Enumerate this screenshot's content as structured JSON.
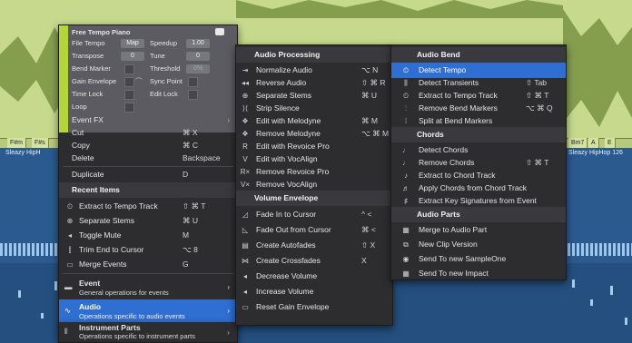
{
  "colors": {
    "audio_track": "#c6d98c",
    "blue_track": "#2a5a8e",
    "menu_bg": "#2d2d30",
    "highlight": "#2f6fd1",
    "tempo_accent": "#b6d43c"
  },
  "background": {
    "chords": [
      "F#m",
      "F#s",
      "Bm7",
      "A",
      "E"
    ],
    "clip_left": "Sleazy HipH",
    "clip_right": "Sleazy HipHop 126"
  },
  "tempo_panel": {
    "title": "Free Tempo Piano",
    "file_tempo_label": "File Tempo",
    "file_tempo_value": "Map",
    "speedup_label": "Speedup",
    "speedup_value": "1.00",
    "transpose_label": "Transpose",
    "transpose_value": "0",
    "tune_label": "Tune",
    "tune_value": "0",
    "bend_marker_label": "Bend Marker",
    "threshold_label": "Threshold",
    "threshold_value": "0%",
    "gain_envelope_label": "Gain Envelope",
    "sync_point_label": "Sync Point",
    "time_lock_label": "Time Lock",
    "edit_lock_label": "Edit Lock",
    "loop_label": "Loop"
  },
  "left_menu": {
    "items": [
      {
        "label": "Event FX",
        "shortcut": "",
        "icon": "",
        "arrow": true
      },
      {
        "label": "Cut",
        "shortcut": "⌘ X",
        "icon": ""
      },
      {
        "label": "Copy",
        "shortcut": "⌘ C",
        "icon": ""
      },
      {
        "label": "Delete",
        "shortcut": "Backspace",
        "icon": ""
      },
      {
        "label": "Duplicate",
        "shortcut": "D",
        "icon": ""
      }
    ],
    "recent_header": "Recent Items",
    "recent": [
      {
        "label": "Extract to Tempo Track",
        "shortcut": "⇧ ⌘ T",
        "icon": "tempo-icon"
      },
      {
        "label": "Separate Stems",
        "shortcut": "⌘ U",
        "icon": "stems-icon"
      },
      {
        "label": "Toggle Mute",
        "shortcut": "M",
        "icon": "mute-icon"
      },
      {
        "label": "Trim End to Cursor",
        "shortcut": "⌥ 8",
        "icon": "trim-icon"
      },
      {
        "label": "Merge Events",
        "shortcut": "G",
        "icon": "merge-icon"
      }
    ],
    "groups": [
      {
        "title": "Event",
        "subtitle": "General operations for events",
        "icon": "event-icon"
      },
      {
        "title": "Audio",
        "subtitle": "Operations specific to audio events",
        "icon": "audio-icon"
      },
      {
        "title": "Instrument Parts",
        "subtitle": "Operations specific to instrument parts",
        "icon": "instrument-icon"
      }
    ]
  },
  "mid_menu": {
    "processing_header": "Audio Processing",
    "processing": [
      {
        "label": "Normalize Audio",
        "shortcut": "⌥ N",
        "icon": "normalize-icon"
      },
      {
        "label": "Reverse Audio",
        "shortcut": "⇧ ⌘ R",
        "icon": "reverse-icon"
      },
      {
        "label": "Separate Stems",
        "shortcut": "⌘ U",
        "icon": "stems-icon"
      },
      {
        "label": "Strip Silence",
        "shortcut": "",
        "icon": "strip-icon"
      },
      {
        "label": "Edit with Melodyne",
        "shortcut": "⌘ M",
        "icon": "melodyne-icon"
      },
      {
        "label": "Remove Melodyne",
        "shortcut": "⌥ ⌘ M",
        "icon": "melodyne-remove-icon"
      },
      {
        "label": "Edit with Revoice Pro",
        "shortcut": "",
        "icon": "revoice-icon"
      },
      {
        "label": "Edit with VocAlign",
        "shortcut": "",
        "icon": "vocalign-icon"
      },
      {
        "label": "Remove Revoice Pro",
        "shortcut": "",
        "icon": "revoice-remove-icon"
      },
      {
        "label": "Remove VocAlign",
        "shortcut": "",
        "icon": "vocalign-remove-icon"
      }
    ],
    "envelope_header": "Volume Envelope",
    "envelope": [
      {
        "label": "Fade In to Cursor",
        "shortcut": "^ <",
        "icon": "fade-in-icon"
      },
      {
        "label": "Fade Out from Cursor",
        "shortcut": "⌘ <",
        "icon": "fade-out-icon"
      },
      {
        "label": "Create Autofades",
        "shortcut": "⇧ X",
        "icon": "autofade-icon"
      },
      {
        "label": "Create Crossfades",
        "shortcut": "X",
        "icon": "crossfade-icon"
      },
      {
        "label": "Decrease Volume",
        "shortcut": "",
        "icon": "volume-down-icon"
      },
      {
        "label": "Increase Volume",
        "shortcut": "",
        "icon": "volume-up-icon"
      },
      {
        "label": "Reset Gain Envelope",
        "shortcut": "",
        "icon": "reset-gain-icon"
      }
    ]
  },
  "right_menu": {
    "bend_header": "Audio Bend",
    "bend": [
      {
        "label": "Detect Tempo",
        "shortcut": "",
        "icon": "detect-tempo-icon"
      },
      {
        "label": "Detect Transients",
        "shortcut": "⇧ Tab",
        "icon": "transients-icon"
      },
      {
        "label": "Extract to Tempo Track",
        "shortcut": "⇧ ⌘ T",
        "icon": "tempo-icon"
      },
      {
        "label": "Remove Bend Markers",
        "shortcut": "⌥ ⌘ Q",
        "icon": "remove-bend-icon"
      },
      {
        "label": "Split at Bend Markers",
        "shortcut": "",
        "icon": "split-bend-icon"
      }
    ],
    "chords_header": "Chords",
    "chords": [
      {
        "label": "Detect Chords",
        "shortcut": "",
        "icon": "detect-chords-icon"
      },
      {
        "label": "Remove Chords",
        "shortcut": "⇧ ⌘ T",
        "icon": "remove-chords-icon"
      },
      {
        "label": "Extract to Chord Track",
        "shortcut": "",
        "icon": "chord-track-icon"
      },
      {
        "label": "Apply Chords from Chord Track",
        "shortcut": "",
        "icon": "apply-chords-icon"
      },
      {
        "label": "Extract Key Signatures from Event",
        "shortcut": "",
        "icon": "key-signature-icon"
      }
    ],
    "parts_header": "Audio Parts",
    "parts": [
      {
        "label": "Merge to Audio Part",
        "shortcut": "",
        "icon": "merge-part-icon"
      },
      {
        "label": "New Clip Version",
        "shortcut": "",
        "icon": "clip-version-icon"
      },
      {
        "label": "Send To new SampleOne",
        "shortcut": "",
        "icon": "sampleone-icon"
      },
      {
        "label": "Send To new Impact",
        "shortcut": "",
        "icon": "impact-icon"
      }
    ]
  }
}
